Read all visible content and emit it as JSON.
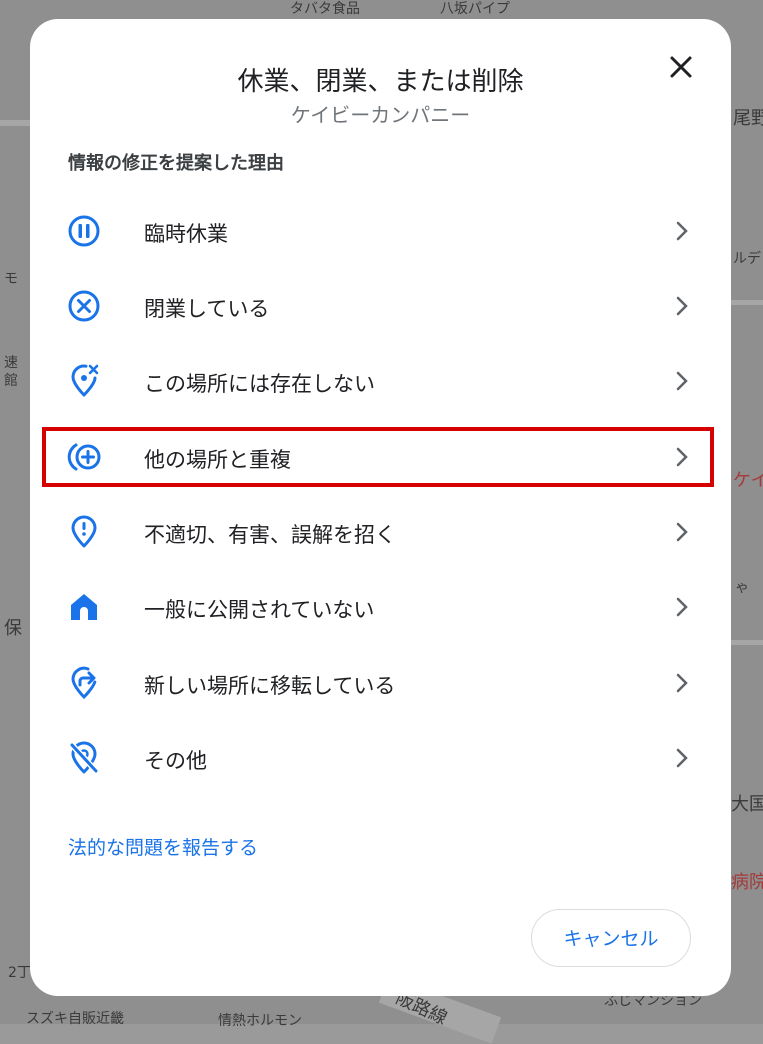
{
  "map": {
    "labels": [
      "タバタ食品",
      "八坂パイプ",
      "尾野",
      "モ",
      "ルデ",
      "速",
      "館",
      "ケイ",
      "ゃ",
      "保",
      "大国",
      "病院",
      "2丁",
      "スズキ自販近畿",
      "情熱ホルモン",
      "阪路線",
      "ふじマンション"
    ]
  },
  "dialog": {
    "title": "休業、閉業、または削除",
    "subtitle": "ケイビーカンパニー",
    "section_heading": "情報の修正を提案した理由",
    "reasons": [
      {
        "label": "臨時休業",
        "icon": "pause-circle-icon"
      },
      {
        "label": "閉業している",
        "icon": "close-circle-icon"
      },
      {
        "label": "この場所には存在しない",
        "icon": "location-off-icon"
      },
      {
        "label": "他の場所と重複",
        "icon": "duplicate-add-icon"
      },
      {
        "label": "不適切、有害、誤解を招く",
        "icon": "location-alert-icon"
      },
      {
        "label": "一般に公開されていない",
        "icon": "home-icon"
      },
      {
        "label": "新しい場所に移転している",
        "icon": "moved-location-icon"
      },
      {
        "label": "その他",
        "icon": "location-crossed-icon"
      }
    ],
    "legal_link": "法的な問題を報告する",
    "cancel_label": "キャンセル"
  },
  "colors": {
    "accent": "#1a73e8",
    "highlight": "#d50000",
    "text": "#202124",
    "secondary": "#70757a"
  }
}
